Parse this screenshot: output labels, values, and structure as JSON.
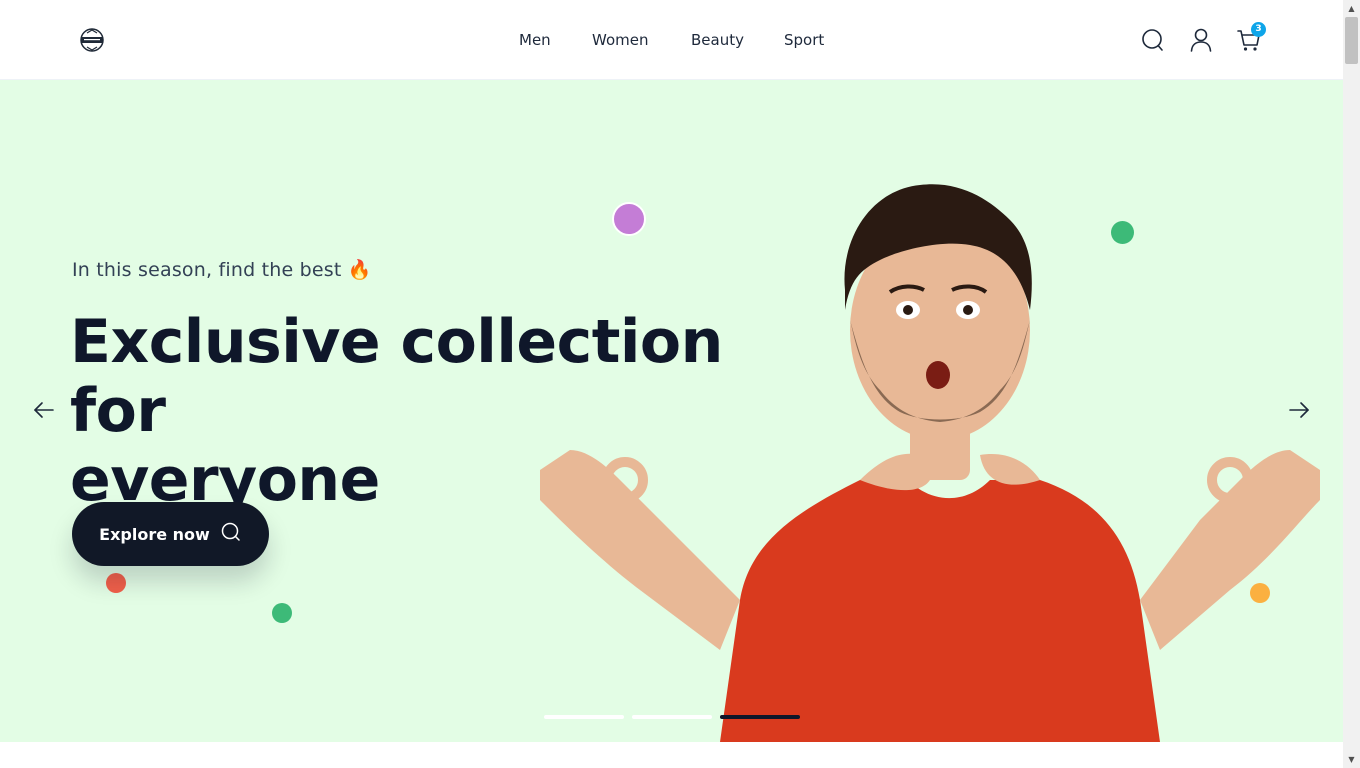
{
  "header": {
    "nav": [
      "Men",
      "Women",
      "Beauty",
      "Sport"
    ],
    "cart_count": "3",
    "icons": [
      "search-icon",
      "user-icon",
      "cart-icon"
    ]
  },
  "hero": {
    "subtitle": "In this season, find the best 🔥",
    "headline_line1": "Exclusive collection for",
    "headline_line2": "everyone",
    "cta_label": "Explore now",
    "active_slide": 3,
    "slide_count": 3,
    "background": "#e3fde5",
    "dot_colors": [
      "#c47dd6",
      "#3dba78",
      "#f2604a",
      "#3dba78",
      "#fbb040"
    ]
  }
}
